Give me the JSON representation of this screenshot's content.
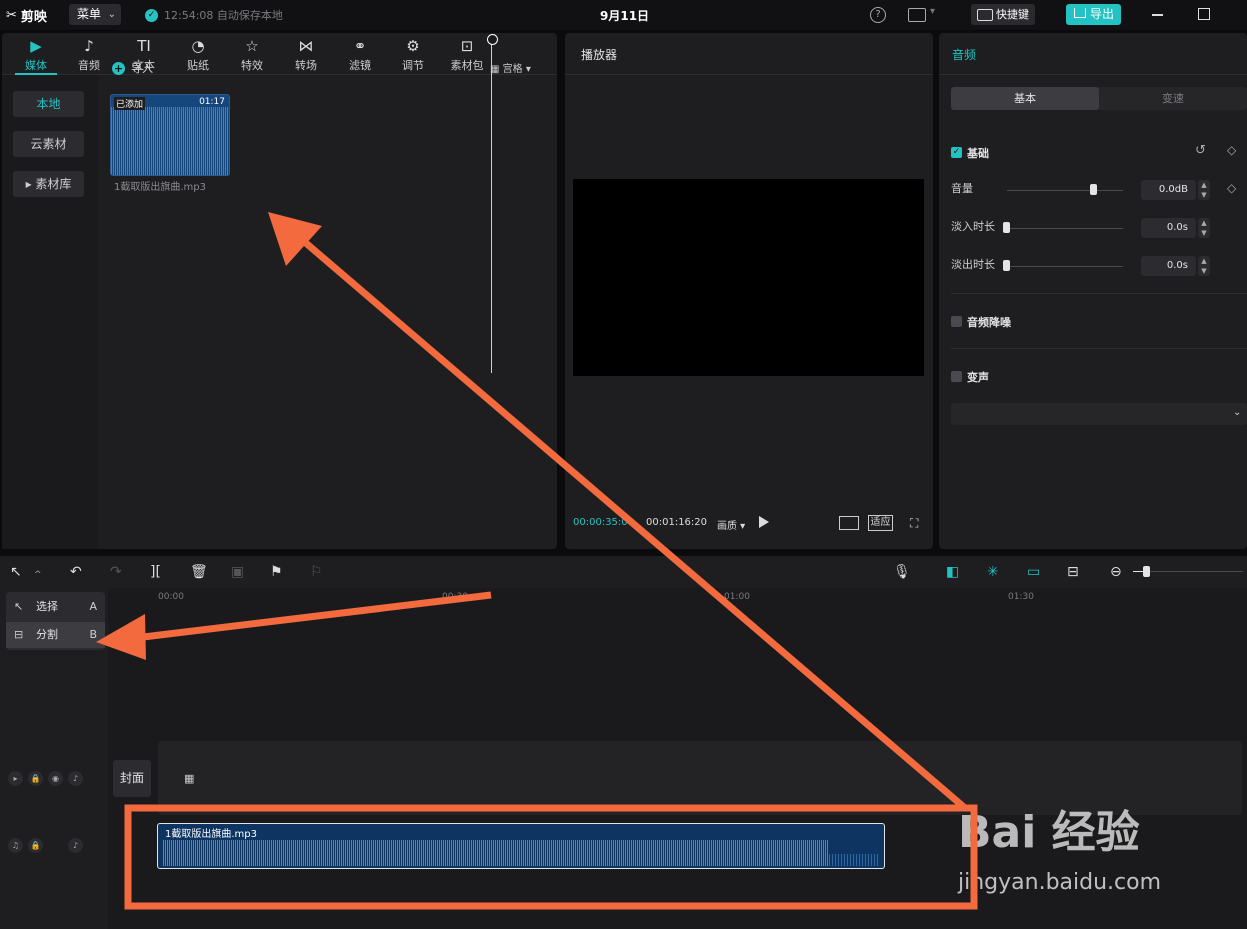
{
  "app": {
    "name": "剪映",
    "menu_label": "菜单",
    "autosave": "12:54:08 自动保存本地",
    "project_title": "9月11日",
    "shortcut_label": "快捷键",
    "export_label": "导出"
  },
  "media_panel": {
    "tabs": [
      {
        "label": "媒体",
        "icon": "media-icon"
      },
      {
        "label": "音频",
        "icon": "audio-icon"
      },
      {
        "label": "文本",
        "icon": "text-icon"
      },
      {
        "label": "贴纸",
        "icon": "sticker-icon"
      },
      {
        "label": "特效",
        "icon": "effects-icon"
      },
      {
        "label": "转场",
        "icon": "transition-icon"
      },
      {
        "label": "滤镜",
        "icon": "filter-icon"
      },
      {
        "label": "调节",
        "icon": "adjust-icon"
      },
      {
        "label": "素材包",
        "icon": "package-icon"
      }
    ],
    "sidebar": [
      "本地",
      "云素材",
      "素材库"
    ],
    "import_label": "导入",
    "view_label": "宫格",
    "asset": {
      "badge": "已添加",
      "duration": "01:17",
      "filename": "1截取版出旗曲.mp3"
    }
  },
  "player": {
    "title": "播放器",
    "current_time": "00:00:35:0",
    "total_time": "00:01:16:20",
    "quality_label": "画质",
    "fit_label": "适应"
  },
  "props": {
    "title": "音频",
    "tabs": [
      "基本",
      "变速"
    ],
    "basic_label": "基础",
    "volume_label": "音量",
    "volume_value": "0.0dB",
    "fadein_label": "淡入时长",
    "fadein_value": "0.0s",
    "fadeout_label": "淡出时长",
    "fadeout_value": "0.0s",
    "denoise_label": "音频降噪",
    "voice_change_label": "变声"
  },
  "timeline": {
    "ticks": [
      "00:00",
      "00:30",
      "01:00",
      "01:30"
    ],
    "tool_menu": [
      {
        "label": "选择",
        "key": "A"
      },
      {
        "label": "分割",
        "key": "B"
      }
    ],
    "cover_label": "封面",
    "audio_clip_name": "1截取版出旗曲.mp3"
  },
  "watermark": {
    "brand": "Bai 经验",
    "url": "jingyan.baidu.com"
  },
  "colors": {
    "accent": "#23c3c3",
    "annotation": "#f26a3d",
    "clip": "#0e3561"
  }
}
